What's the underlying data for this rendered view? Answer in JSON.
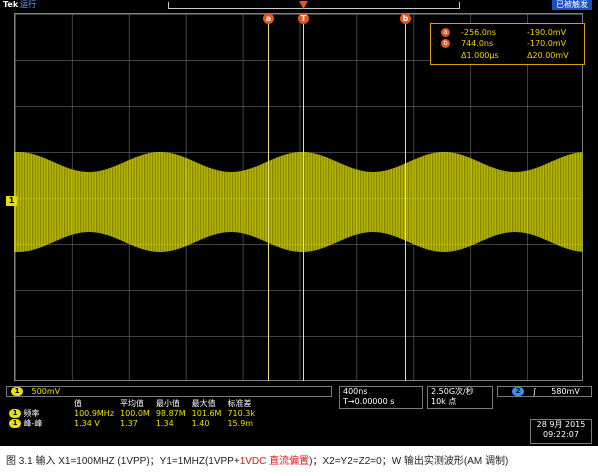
{
  "topbar": {
    "brand": "Tek",
    "run_label": "运行",
    "status": "已被触发"
  },
  "markers": {
    "cursor_a": "a",
    "trigger": "T",
    "cursor_b": "b",
    "channel1": "1"
  },
  "readout": {
    "row_a": {
      "badge": "a",
      "time": "-256.0ns",
      "voltage": "-190.0mV"
    },
    "row_b": {
      "badge": "b",
      "time": "744.0ns",
      "voltage": "-170.0mV"
    },
    "delta": {
      "time": "Δ1.000μs",
      "voltage": "Δ20.00mV"
    }
  },
  "waveform": {
    "color": "#e6e600",
    "type": "AM"
  },
  "channel_panel": {
    "badge": "1",
    "scale": "500mV"
  },
  "timebase_panel": {
    "scale": "400ns",
    "position": "T→0.00000 s"
  },
  "acq_panel": {
    "rate": "2.50G次/秒",
    "points": "10k 点"
  },
  "trigger_panel": {
    "badge": "2",
    "slope": "∫",
    "level": "580mV"
  },
  "measurements": {
    "headers": [
      "值",
      "平均值",
      "最小值",
      "最大值",
      "标准差"
    ],
    "rows": [
      {
        "badge": "1",
        "name": "频率",
        "values": [
          "100.9MHz",
          "100.0M",
          "98.87M",
          "101.6M",
          "710.3k"
        ]
      },
      {
        "badge": "1",
        "name": "峰-峰",
        "values": [
          "1.34 V",
          "1.37",
          "1.34",
          "1.40",
          "15.9m"
        ]
      }
    ]
  },
  "datetime": {
    "date": "28 9月 2015",
    "time": "09:22:07"
  },
  "caption": {
    "prefix": "图 3.1  输入 X1=100MHZ (1VPP)；Y1=1MHZ(1VPP+",
    "red": "1VDC 直流偏置",
    "suffix": ")；X2=Y2=Z2=0；W 输出实测波形(AM 调制)"
  }
}
